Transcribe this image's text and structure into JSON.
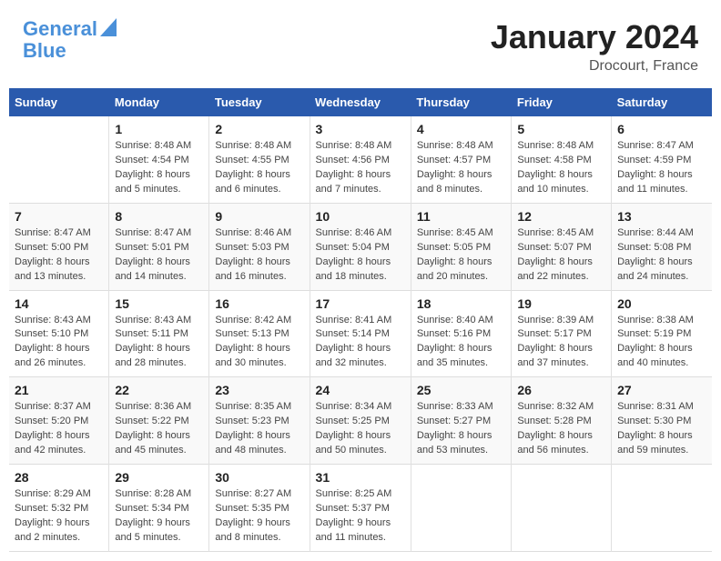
{
  "logo": {
    "line1": "General",
    "line2": "Blue"
  },
  "title": "January 2024",
  "location": "Drocourt, France",
  "weekdays": [
    "Sunday",
    "Monday",
    "Tuesday",
    "Wednesday",
    "Thursday",
    "Friday",
    "Saturday"
  ],
  "weeks": [
    [
      {
        "day": "",
        "text": ""
      },
      {
        "day": "1",
        "text": "Sunrise: 8:48 AM\nSunset: 4:54 PM\nDaylight: 8 hours\nand 5 minutes."
      },
      {
        "day": "2",
        "text": "Sunrise: 8:48 AM\nSunset: 4:55 PM\nDaylight: 8 hours\nand 6 minutes."
      },
      {
        "day": "3",
        "text": "Sunrise: 8:48 AM\nSunset: 4:56 PM\nDaylight: 8 hours\nand 7 minutes."
      },
      {
        "day": "4",
        "text": "Sunrise: 8:48 AM\nSunset: 4:57 PM\nDaylight: 8 hours\nand 8 minutes."
      },
      {
        "day": "5",
        "text": "Sunrise: 8:48 AM\nSunset: 4:58 PM\nDaylight: 8 hours\nand 10 minutes."
      },
      {
        "day": "6",
        "text": "Sunrise: 8:47 AM\nSunset: 4:59 PM\nDaylight: 8 hours\nand 11 minutes."
      }
    ],
    [
      {
        "day": "7",
        "text": "Sunrise: 8:47 AM\nSunset: 5:00 PM\nDaylight: 8 hours\nand 13 minutes."
      },
      {
        "day": "8",
        "text": "Sunrise: 8:47 AM\nSunset: 5:01 PM\nDaylight: 8 hours\nand 14 minutes."
      },
      {
        "day": "9",
        "text": "Sunrise: 8:46 AM\nSunset: 5:03 PM\nDaylight: 8 hours\nand 16 minutes."
      },
      {
        "day": "10",
        "text": "Sunrise: 8:46 AM\nSunset: 5:04 PM\nDaylight: 8 hours\nand 18 minutes."
      },
      {
        "day": "11",
        "text": "Sunrise: 8:45 AM\nSunset: 5:05 PM\nDaylight: 8 hours\nand 20 minutes."
      },
      {
        "day": "12",
        "text": "Sunrise: 8:45 AM\nSunset: 5:07 PM\nDaylight: 8 hours\nand 22 minutes."
      },
      {
        "day": "13",
        "text": "Sunrise: 8:44 AM\nSunset: 5:08 PM\nDaylight: 8 hours\nand 24 minutes."
      }
    ],
    [
      {
        "day": "14",
        "text": "Sunrise: 8:43 AM\nSunset: 5:10 PM\nDaylight: 8 hours\nand 26 minutes."
      },
      {
        "day": "15",
        "text": "Sunrise: 8:43 AM\nSunset: 5:11 PM\nDaylight: 8 hours\nand 28 minutes."
      },
      {
        "day": "16",
        "text": "Sunrise: 8:42 AM\nSunset: 5:13 PM\nDaylight: 8 hours\nand 30 minutes."
      },
      {
        "day": "17",
        "text": "Sunrise: 8:41 AM\nSunset: 5:14 PM\nDaylight: 8 hours\nand 32 minutes."
      },
      {
        "day": "18",
        "text": "Sunrise: 8:40 AM\nSunset: 5:16 PM\nDaylight: 8 hours\nand 35 minutes."
      },
      {
        "day": "19",
        "text": "Sunrise: 8:39 AM\nSunset: 5:17 PM\nDaylight: 8 hours\nand 37 minutes."
      },
      {
        "day": "20",
        "text": "Sunrise: 8:38 AM\nSunset: 5:19 PM\nDaylight: 8 hours\nand 40 minutes."
      }
    ],
    [
      {
        "day": "21",
        "text": "Sunrise: 8:37 AM\nSunset: 5:20 PM\nDaylight: 8 hours\nand 42 minutes."
      },
      {
        "day": "22",
        "text": "Sunrise: 8:36 AM\nSunset: 5:22 PM\nDaylight: 8 hours\nand 45 minutes."
      },
      {
        "day": "23",
        "text": "Sunrise: 8:35 AM\nSunset: 5:23 PM\nDaylight: 8 hours\nand 48 minutes."
      },
      {
        "day": "24",
        "text": "Sunrise: 8:34 AM\nSunset: 5:25 PM\nDaylight: 8 hours\nand 50 minutes."
      },
      {
        "day": "25",
        "text": "Sunrise: 8:33 AM\nSunset: 5:27 PM\nDaylight: 8 hours\nand 53 minutes."
      },
      {
        "day": "26",
        "text": "Sunrise: 8:32 AM\nSunset: 5:28 PM\nDaylight: 8 hours\nand 56 minutes."
      },
      {
        "day": "27",
        "text": "Sunrise: 8:31 AM\nSunset: 5:30 PM\nDaylight: 8 hours\nand 59 minutes."
      }
    ],
    [
      {
        "day": "28",
        "text": "Sunrise: 8:29 AM\nSunset: 5:32 PM\nDaylight: 9 hours\nand 2 minutes."
      },
      {
        "day": "29",
        "text": "Sunrise: 8:28 AM\nSunset: 5:34 PM\nDaylight: 9 hours\nand 5 minutes."
      },
      {
        "day": "30",
        "text": "Sunrise: 8:27 AM\nSunset: 5:35 PM\nDaylight: 9 hours\nand 8 minutes."
      },
      {
        "day": "31",
        "text": "Sunrise: 8:25 AM\nSunset: 5:37 PM\nDaylight: 9 hours\nand 11 minutes."
      },
      {
        "day": "",
        "text": ""
      },
      {
        "day": "",
        "text": ""
      },
      {
        "day": "",
        "text": ""
      }
    ]
  ]
}
